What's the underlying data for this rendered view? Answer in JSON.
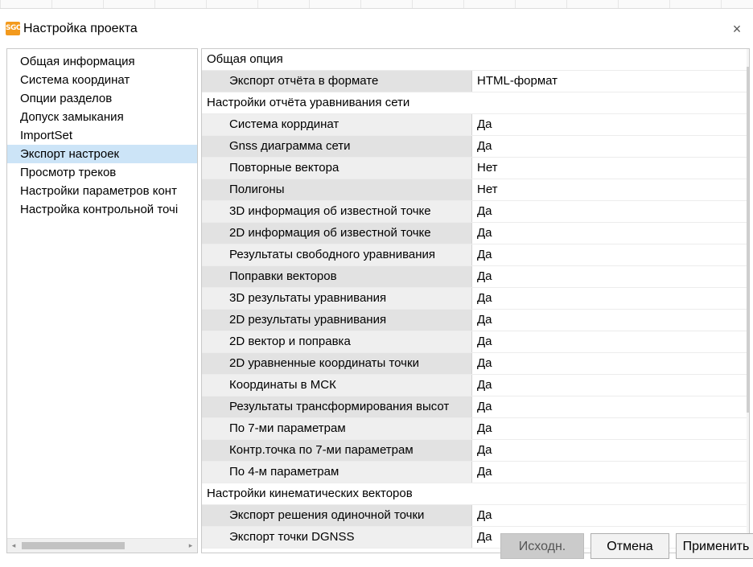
{
  "window": {
    "title": "Настройка проекта",
    "app_icon_text": "SGO",
    "close_glyph": "×",
    "accent": "#f39a1d"
  },
  "nav": {
    "items": [
      "Общая информация",
      "Система координат",
      "Опции разделов",
      "Допуск замыкания",
      "ImportSet",
      "Экспорт настроек",
      "Просмотр треков",
      "Настройки параметров конт",
      "Настройка контрольной точі"
    ],
    "selected_index": 5,
    "selected_color": "#cce4f7"
  },
  "grid": {
    "rows": [
      {
        "type": "section",
        "label": "Общая опция"
      },
      {
        "type": "prop",
        "name": "Экспорт отчёта в формате",
        "value": "HTML-формат"
      },
      {
        "type": "section",
        "label": "Настройки отчёта уравнивания сети"
      },
      {
        "type": "prop",
        "name": "Система коррдинат",
        "value": "Да"
      },
      {
        "type": "prop",
        "name": "Gnss диаграмма сети",
        "value": "Да"
      },
      {
        "type": "prop",
        "name": "Повторные вектора",
        "value": "Нет"
      },
      {
        "type": "prop",
        "name": "Полигоны",
        "value": "Нет"
      },
      {
        "type": "prop",
        "name": "3D информация об известной точке",
        "value": "Да"
      },
      {
        "type": "prop",
        "name": "2D информация об известной точке",
        "value": "Да"
      },
      {
        "type": "prop",
        "name": "Результаты свободного уравнивания",
        "value": "Да"
      },
      {
        "type": "prop",
        "name": "Поправки векторов",
        "value": "Да"
      },
      {
        "type": "prop",
        "name": "3D результаты уравнивания",
        "value": "Да"
      },
      {
        "type": "prop",
        "name": "2D результаты уравнивания",
        "value": "Да"
      },
      {
        "type": "prop",
        "name": "2D вектор и поправка",
        "value": "Да"
      },
      {
        "type": "prop",
        "name": "2D уравненные координаты точки",
        "value": "Да"
      },
      {
        "type": "prop",
        "name": "Координаты в МСК",
        "value": "Да"
      },
      {
        "type": "prop",
        "name": "Результаты трансформирования высот",
        "value": "Да"
      },
      {
        "type": "prop",
        "name": "По 7-ми параметрам",
        "value": "Да"
      },
      {
        "type": "prop",
        "name": "Контр.точка по 7-ми параметрам",
        "value": "Да"
      },
      {
        "type": "prop",
        "name": "По 4-м параметрам",
        "value": "Да"
      },
      {
        "type": "section",
        "label": "Настройки кинематических векторов"
      },
      {
        "type": "prop",
        "name": "Экспорт решения одиночной точки",
        "value": "Да"
      },
      {
        "type": "prop",
        "name": "Экспорт точки DGNSS",
        "value": "Да"
      }
    ]
  },
  "buttons": {
    "default_label": "Исходн.",
    "cancel_label": "Отмена",
    "apply_label": "Применить"
  },
  "icons": {
    "scroll_left": "◂",
    "scroll_right": "▸"
  }
}
